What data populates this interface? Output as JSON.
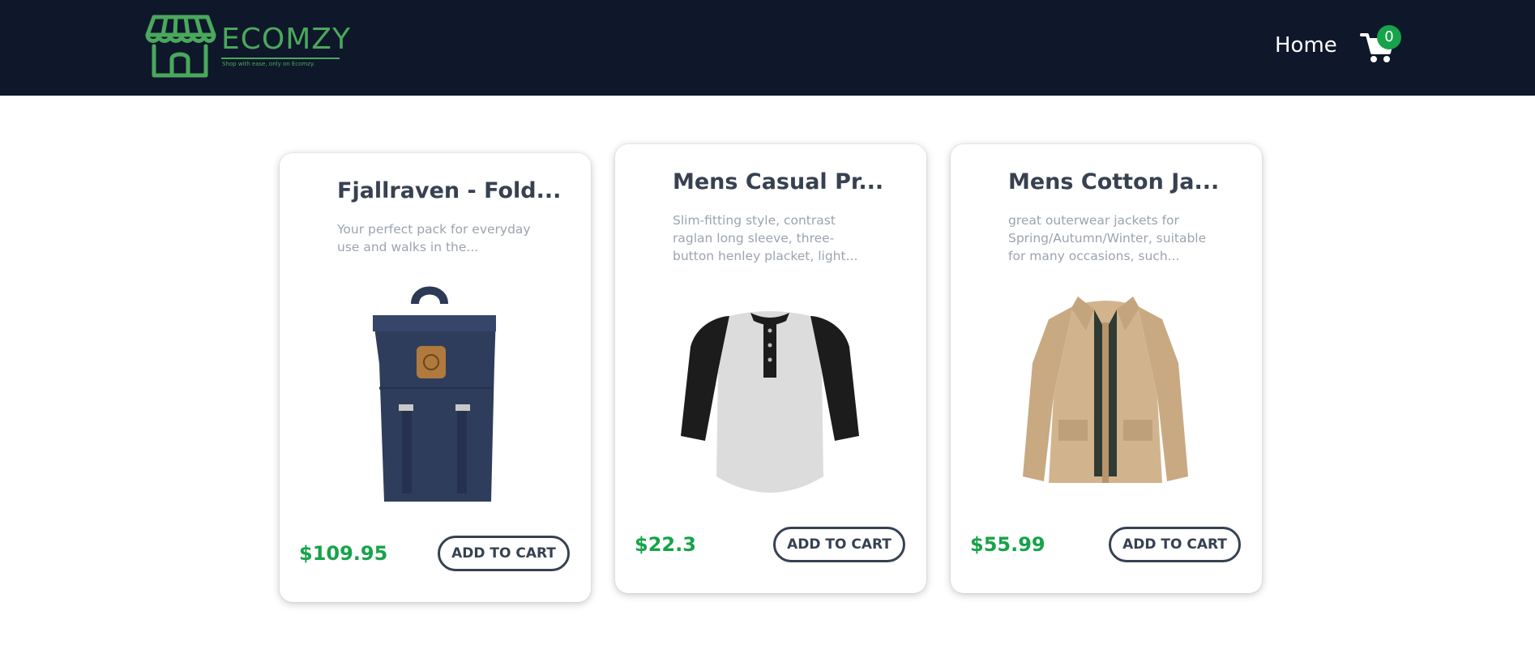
{
  "header": {
    "brand": "ECOMZY",
    "tagline": "Shop with ease, only on Ecomzy.",
    "nav_home": "Home",
    "cart_count": "0",
    "cart_icon": "cart-icon",
    "logo_icon": "storefront-icon",
    "bg_color": "#0f172a",
    "brand_color": "#4aa85c"
  },
  "products": [
    {
      "title": "Fjallraven - Fold...",
      "description": "Your perfect pack for everyday use and walks in the...",
      "price": "$109.95",
      "button_label": "ADD TO CART",
      "image": "backpack-image"
    },
    {
      "title": "Mens Casual Pr...",
      "description": "Slim-fitting style, contrast raglan long sleeve, three-button henley placket, light...",
      "price": "$22.3",
      "button_label": "ADD TO CART",
      "image": "raglan-shirt-image"
    },
    {
      "title": "Mens Cotton Ja...",
      "description": "great outerwear jackets for Spring/Autumn/Winter, suitable for many occasions, such...",
      "price": "$55.99",
      "button_label": "ADD TO CART",
      "image": "jacket-image"
    }
  ],
  "colors": {
    "price": "#16a34a",
    "title": "#374151",
    "description": "#9ca3af",
    "badge": "#16a34a"
  }
}
